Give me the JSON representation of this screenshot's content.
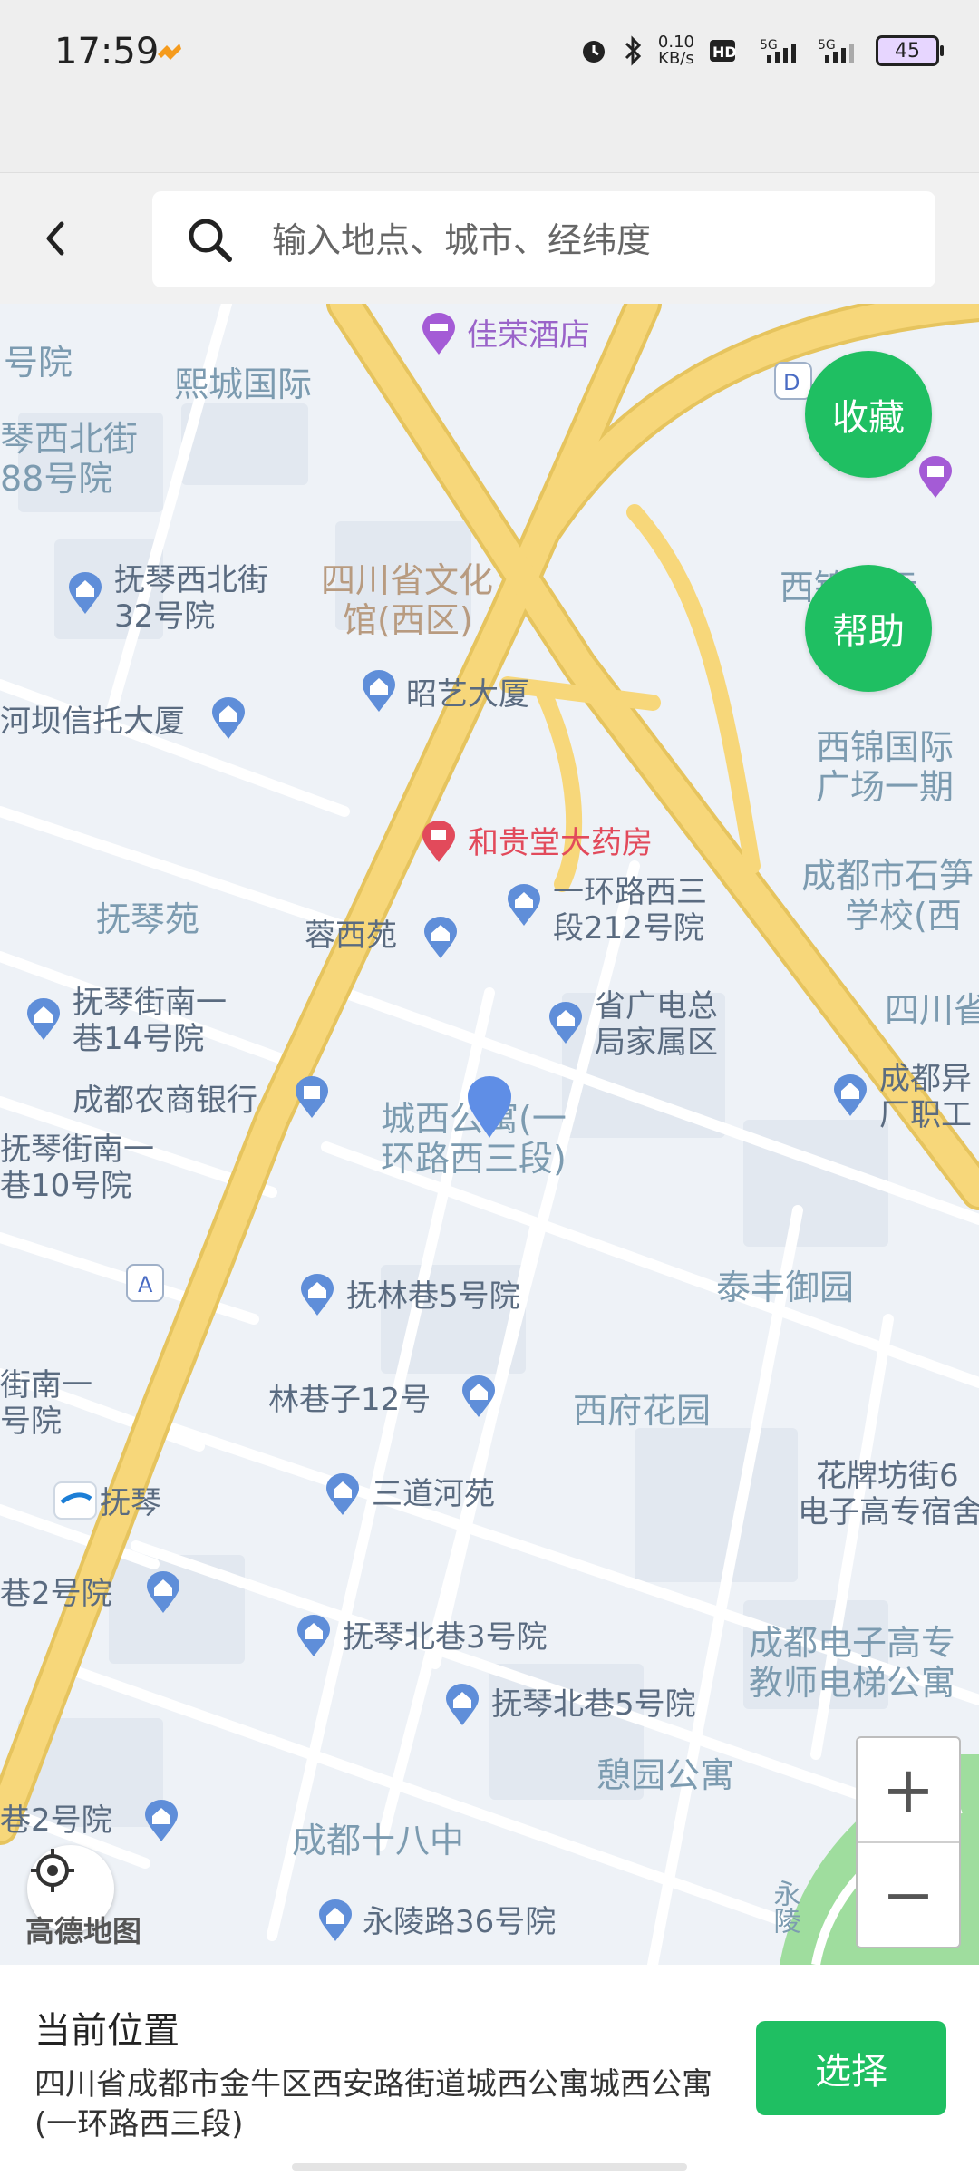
{
  "status": {
    "time": "17:59",
    "net_speed": "0.10\nKB/s",
    "battery": "45"
  },
  "search": {
    "placeholder": "输入地点、城市、经纬度"
  },
  "map": {
    "labels": [
      "佳荣酒店",
      "号院",
      "熙城国际",
      "琴西北街",
      "88号院",
      "抚琴西北街",
      "32号院",
      "四川省文化",
      "馆(西区)",
      "昭艺大厦",
      "河坝信托大厦",
      "西锦国际",
      "西锦国际",
      "广场一期",
      "成都市石笋",
      "学校(西",
      "和贵堂大药房",
      "一环路西三",
      "段212号院",
      "抚琴苑",
      "蓉西苑",
      "四川省",
      "省广电总",
      "局家属区",
      "抚琴街南一",
      "巷14号院",
      "成都农商银行",
      "城西公寓(一",
      "环路西三段)",
      "成都异",
      "厂职工",
      "抚琴街南一",
      "巷10号院",
      "泰丰御园",
      "抚林巷5号院",
      "街南一",
      "号院",
      "林巷子12号",
      "西府花园",
      "抚琴",
      "三道河苑",
      "花牌坊街6",
      "电子高专宿舍",
      "巷2号院",
      "抚琴北巷3号院",
      "成都电子高专",
      "教师电梯公寓",
      "抚琴北巷5号院",
      "憩园公寓",
      "巷2号院",
      "成都十八中",
      "永陵路36号院",
      "永陵",
      "高德地图"
    ]
  },
  "buttons": {
    "favorite": "收藏",
    "help": "帮助",
    "zoom_in": "+",
    "zoom_out": "−",
    "choose": "选择"
  },
  "current": {
    "title": "当前位置",
    "address": "四川省成都市金牛区西安路街道城西公寓城西公寓(一环路西三段)"
  },
  "colors": {
    "accent": "#1fbf62",
    "road_major": "#f7d77a",
    "map_bg": "#eef2f7"
  }
}
